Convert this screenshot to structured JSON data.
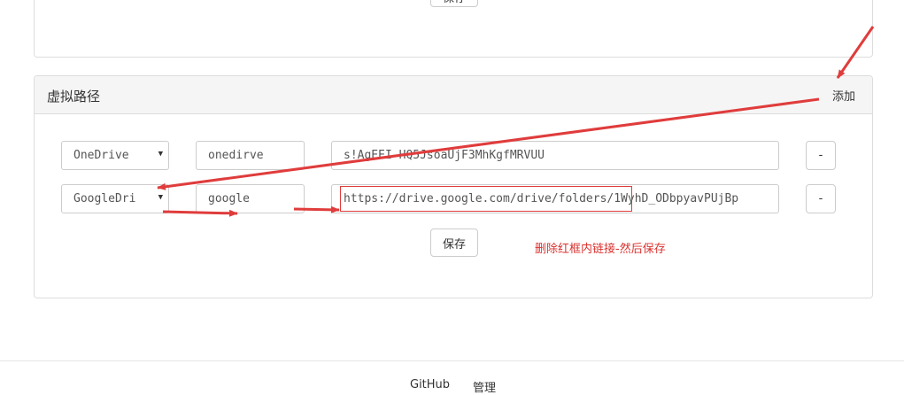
{
  "top_panel": {
    "save_label": "保存"
  },
  "vpath": {
    "title": "虚拟路径",
    "add_label": "添加",
    "rows": [
      {
        "provider": "OneDrive",
        "name": "onedirve",
        "url": "s!AgEEI-HQ5JsoaUjF3MhKgfMRVUU",
        "remove_label": "-"
      },
      {
        "provider": "GoogleDri",
        "name": "google",
        "url": "https://drive.google.com/drive/folders/1WyhD_ODbpyavPUjBp",
        "remove_label": "-"
      }
    ],
    "save_label": "保存",
    "note": "删除红框内链接-然后保存"
  },
  "footer": {
    "github": "GitHub",
    "admin": "管理"
  },
  "colors": {
    "annotation": "#e03c3c"
  }
}
